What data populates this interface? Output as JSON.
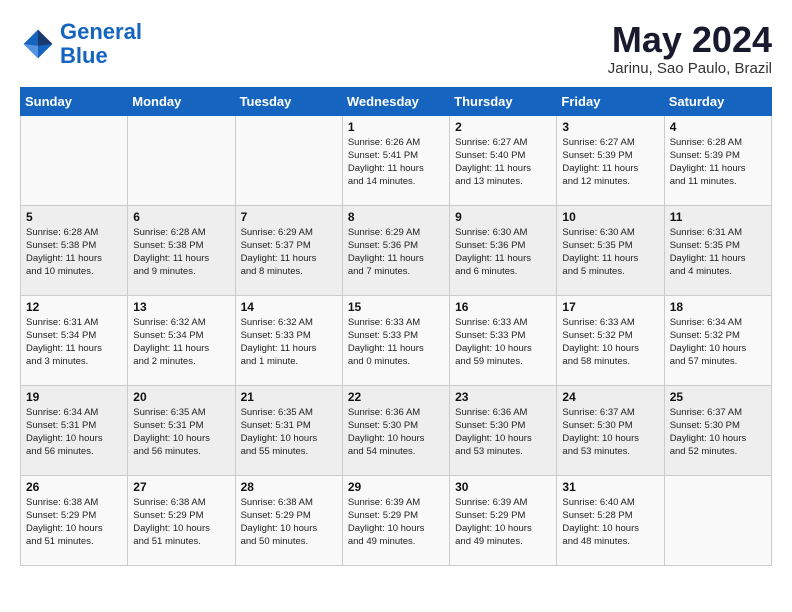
{
  "logo": {
    "line1": "General",
    "line2": "Blue"
  },
  "title": "May 2024",
  "subtitle": "Jarinu, Sao Paulo, Brazil",
  "days_header": [
    "Sunday",
    "Monday",
    "Tuesday",
    "Wednesday",
    "Thursday",
    "Friday",
    "Saturday"
  ],
  "weeks": [
    [
      {
        "day": "",
        "info": ""
      },
      {
        "day": "",
        "info": ""
      },
      {
        "day": "",
        "info": ""
      },
      {
        "day": "1",
        "info": "Sunrise: 6:26 AM\nSunset: 5:41 PM\nDaylight: 11 hours\nand 14 minutes."
      },
      {
        "day": "2",
        "info": "Sunrise: 6:27 AM\nSunset: 5:40 PM\nDaylight: 11 hours\nand 13 minutes."
      },
      {
        "day": "3",
        "info": "Sunrise: 6:27 AM\nSunset: 5:39 PM\nDaylight: 11 hours\nand 12 minutes."
      },
      {
        "day": "4",
        "info": "Sunrise: 6:28 AM\nSunset: 5:39 PM\nDaylight: 11 hours\nand 11 minutes."
      }
    ],
    [
      {
        "day": "5",
        "info": "Sunrise: 6:28 AM\nSunset: 5:38 PM\nDaylight: 11 hours\nand 10 minutes."
      },
      {
        "day": "6",
        "info": "Sunrise: 6:28 AM\nSunset: 5:38 PM\nDaylight: 11 hours\nand 9 minutes."
      },
      {
        "day": "7",
        "info": "Sunrise: 6:29 AM\nSunset: 5:37 PM\nDaylight: 11 hours\nand 8 minutes."
      },
      {
        "day": "8",
        "info": "Sunrise: 6:29 AM\nSunset: 5:36 PM\nDaylight: 11 hours\nand 7 minutes."
      },
      {
        "day": "9",
        "info": "Sunrise: 6:30 AM\nSunset: 5:36 PM\nDaylight: 11 hours\nand 6 minutes."
      },
      {
        "day": "10",
        "info": "Sunrise: 6:30 AM\nSunset: 5:35 PM\nDaylight: 11 hours\nand 5 minutes."
      },
      {
        "day": "11",
        "info": "Sunrise: 6:31 AM\nSunset: 5:35 PM\nDaylight: 11 hours\nand 4 minutes."
      }
    ],
    [
      {
        "day": "12",
        "info": "Sunrise: 6:31 AM\nSunset: 5:34 PM\nDaylight: 11 hours\nand 3 minutes."
      },
      {
        "day": "13",
        "info": "Sunrise: 6:32 AM\nSunset: 5:34 PM\nDaylight: 11 hours\nand 2 minutes."
      },
      {
        "day": "14",
        "info": "Sunrise: 6:32 AM\nSunset: 5:33 PM\nDaylight: 11 hours\nand 1 minute."
      },
      {
        "day": "15",
        "info": "Sunrise: 6:33 AM\nSunset: 5:33 PM\nDaylight: 11 hours\nand 0 minutes."
      },
      {
        "day": "16",
        "info": "Sunrise: 6:33 AM\nSunset: 5:33 PM\nDaylight: 10 hours\nand 59 minutes."
      },
      {
        "day": "17",
        "info": "Sunrise: 6:33 AM\nSunset: 5:32 PM\nDaylight: 10 hours\nand 58 minutes."
      },
      {
        "day": "18",
        "info": "Sunrise: 6:34 AM\nSunset: 5:32 PM\nDaylight: 10 hours\nand 57 minutes."
      }
    ],
    [
      {
        "day": "19",
        "info": "Sunrise: 6:34 AM\nSunset: 5:31 PM\nDaylight: 10 hours\nand 56 minutes."
      },
      {
        "day": "20",
        "info": "Sunrise: 6:35 AM\nSunset: 5:31 PM\nDaylight: 10 hours\nand 56 minutes."
      },
      {
        "day": "21",
        "info": "Sunrise: 6:35 AM\nSunset: 5:31 PM\nDaylight: 10 hours\nand 55 minutes."
      },
      {
        "day": "22",
        "info": "Sunrise: 6:36 AM\nSunset: 5:30 PM\nDaylight: 10 hours\nand 54 minutes."
      },
      {
        "day": "23",
        "info": "Sunrise: 6:36 AM\nSunset: 5:30 PM\nDaylight: 10 hours\nand 53 minutes."
      },
      {
        "day": "24",
        "info": "Sunrise: 6:37 AM\nSunset: 5:30 PM\nDaylight: 10 hours\nand 53 minutes."
      },
      {
        "day": "25",
        "info": "Sunrise: 6:37 AM\nSunset: 5:30 PM\nDaylight: 10 hours\nand 52 minutes."
      }
    ],
    [
      {
        "day": "26",
        "info": "Sunrise: 6:38 AM\nSunset: 5:29 PM\nDaylight: 10 hours\nand 51 minutes."
      },
      {
        "day": "27",
        "info": "Sunrise: 6:38 AM\nSunset: 5:29 PM\nDaylight: 10 hours\nand 51 minutes."
      },
      {
        "day": "28",
        "info": "Sunrise: 6:38 AM\nSunset: 5:29 PM\nDaylight: 10 hours\nand 50 minutes."
      },
      {
        "day": "29",
        "info": "Sunrise: 6:39 AM\nSunset: 5:29 PM\nDaylight: 10 hours\nand 49 minutes."
      },
      {
        "day": "30",
        "info": "Sunrise: 6:39 AM\nSunset: 5:29 PM\nDaylight: 10 hours\nand 49 minutes."
      },
      {
        "day": "31",
        "info": "Sunrise: 6:40 AM\nSunset: 5:28 PM\nDaylight: 10 hours\nand 48 minutes."
      },
      {
        "day": "",
        "info": ""
      }
    ]
  ]
}
